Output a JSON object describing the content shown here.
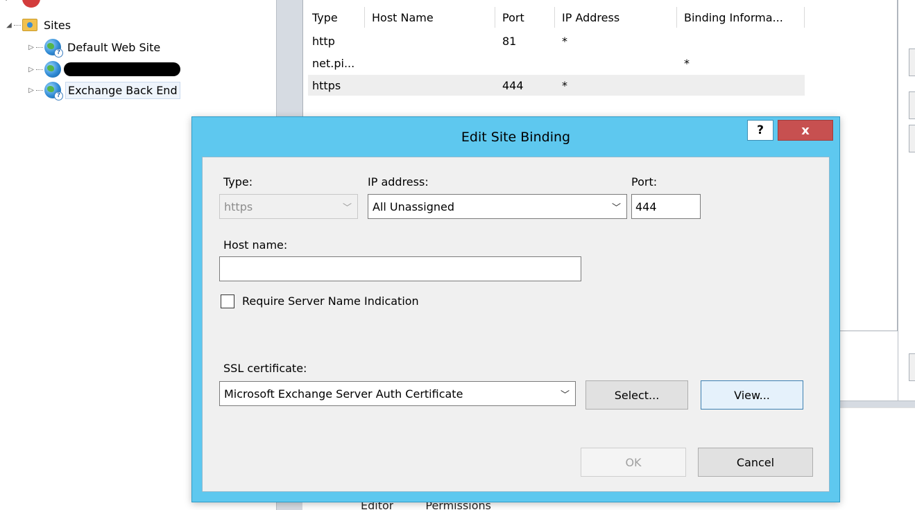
{
  "tree": {
    "sites_label": "Sites",
    "items": [
      {
        "label": "Default Web Site"
      },
      {
        "label": ""
      },
      {
        "label": "Exchange Back End"
      }
    ]
  },
  "bindings_table": {
    "columns": [
      "Type",
      "Host Name",
      "Port",
      "IP Address",
      "Binding Informa..."
    ],
    "rows": [
      {
        "type": "http",
        "host": "",
        "port": "81",
        "ip": "*",
        "info": ""
      },
      {
        "type": "net.pi...",
        "host": "",
        "port": "",
        "ip": "",
        "info": "*"
      },
      {
        "type": "https",
        "host": "",
        "port": "444",
        "ip": "*",
        "info": ""
      }
    ]
  },
  "bottom_tabs": [
    "Editor",
    "Permissions"
  ],
  "dialog": {
    "title": "Edit Site Binding",
    "help_label": "?",
    "close_label": "x",
    "type_label": "Type:",
    "type_value": "https",
    "ip_label": "IP address:",
    "ip_value": "All Unassigned",
    "port_label": "Port:",
    "port_value": "444",
    "host_label": "Host name:",
    "host_value": "",
    "sni_label": "Require Server Name Indication",
    "sni_checked": false,
    "ssl_label": "SSL certificate:",
    "ssl_value": "Microsoft Exchange Server Auth Certificate",
    "select_label": "Select...",
    "view_label": "View...",
    "ok_label": "OK",
    "cancel_label": "Cancel"
  },
  "colors": {
    "dialog_frame": "#5ec8ef",
    "close_button": "#c75050",
    "selected_row": "#eeeeee"
  }
}
